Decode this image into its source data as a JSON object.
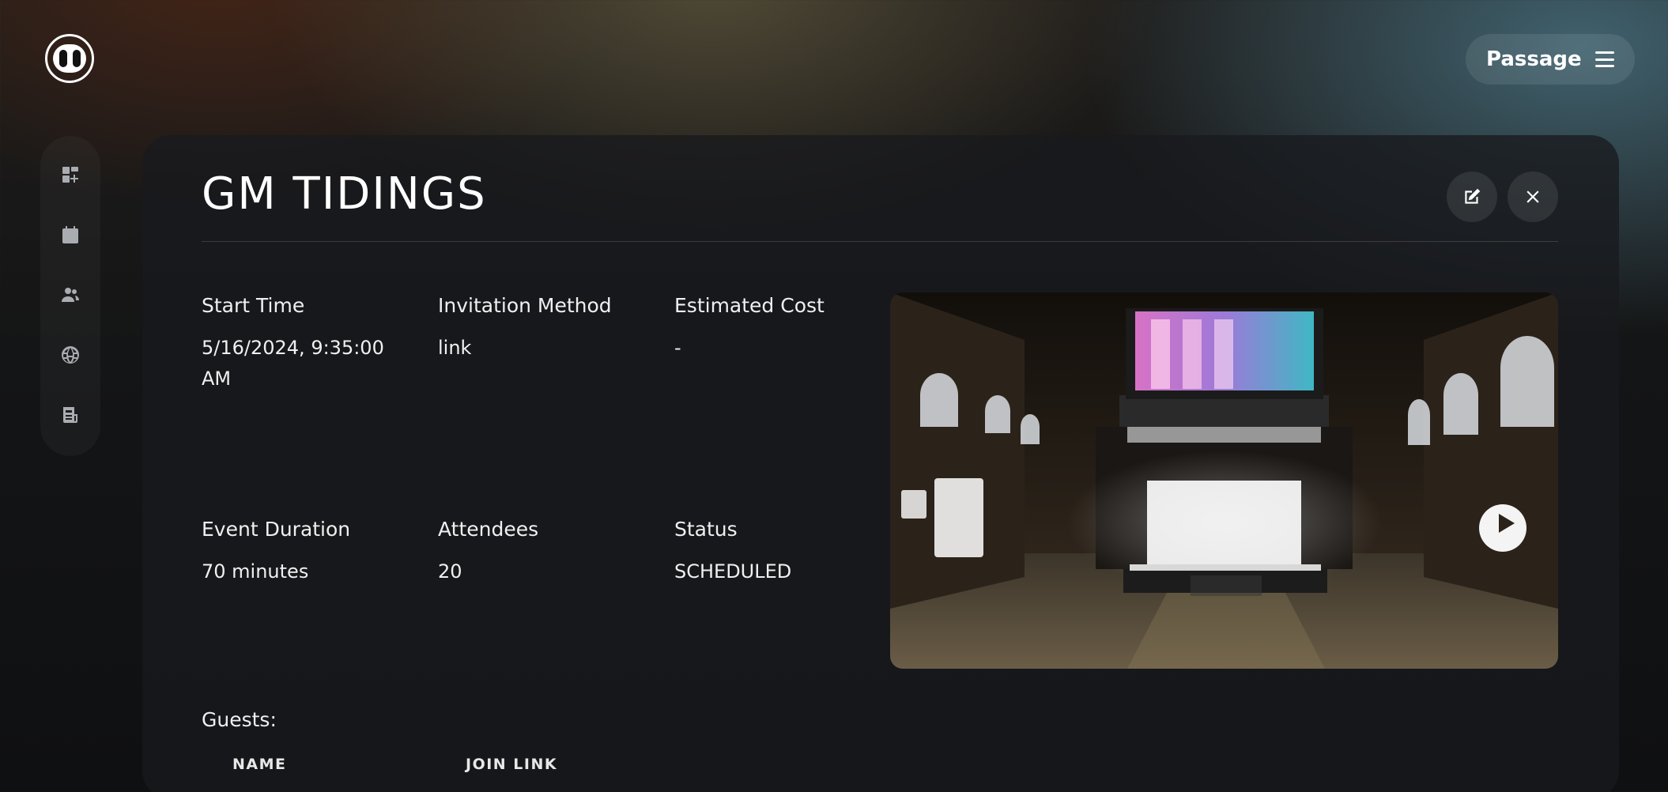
{
  "app": {
    "menu_label": "Passage"
  },
  "sidebar": {
    "items": [
      {
        "icon": "dashboard-add-icon"
      },
      {
        "icon": "calendar-icon"
      },
      {
        "icon": "users-icon"
      },
      {
        "icon": "globe-icon"
      },
      {
        "icon": "news-icon"
      }
    ]
  },
  "event": {
    "title": "GM TIDINGS",
    "fields": {
      "start_time": {
        "label": "Start Time",
        "value": "5/16/2024, 9:35:00 AM"
      },
      "invitation_method": {
        "label": "Invitation Method",
        "value": "link"
      },
      "estimated_cost": {
        "label": "Estimated Cost",
        "value": "-"
      },
      "event_duration": {
        "label": "Event Duration",
        "value": "70 minutes"
      },
      "attendees": {
        "label": "Attendees",
        "value": "20"
      },
      "status": {
        "label": "Status",
        "value": "SCHEDULED"
      }
    },
    "guests": {
      "label": "Guests:",
      "columns": [
        "NAME",
        "JOIN LINK"
      ]
    }
  }
}
